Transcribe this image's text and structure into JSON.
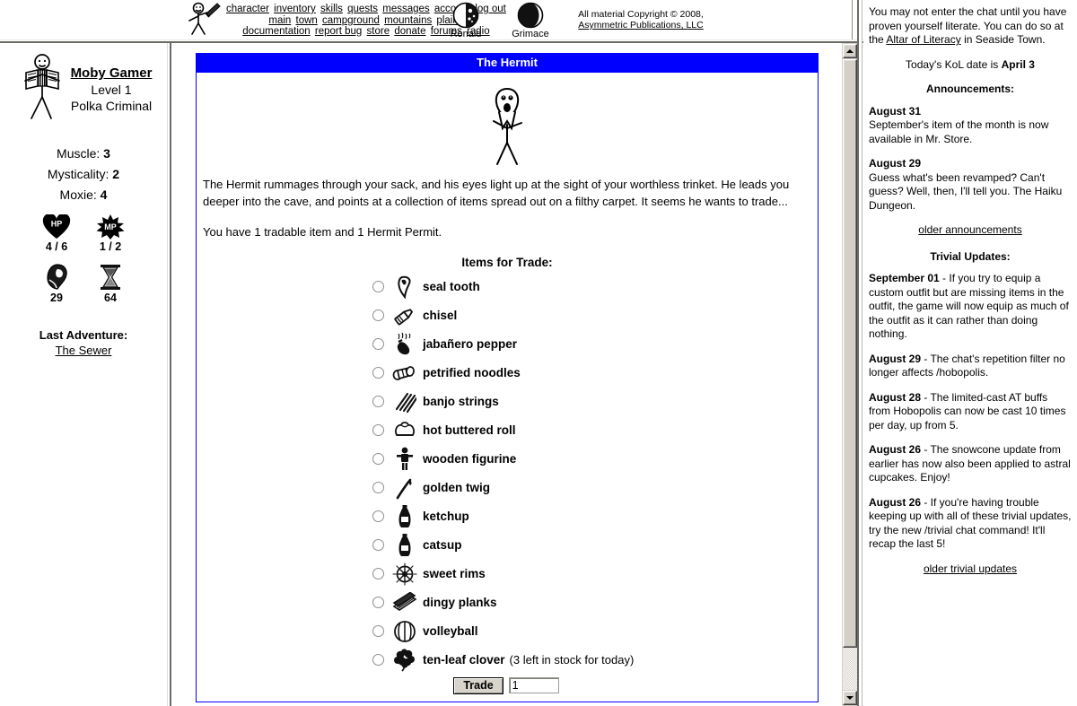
{
  "topnav": {
    "figure_icon": "stick-figure-with-sword-icon",
    "rows": [
      [
        "character",
        "inventory",
        "skills",
        "quests",
        "messages",
        "account",
        "log out"
      ],
      [
        "main",
        "town",
        "campground",
        "mountains",
        "plains"
      ],
      [
        "documentation",
        "report bug",
        "store",
        "donate",
        "forums",
        "radio"
      ]
    ],
    "moons": [
      {
        "name": "Ronald",
        "icon": "moon-phase-icon"
      },
      {
        "name": "Grimace",
        "icon": "moon-phase-icon"
      }
    ],
    "copyright_line1": "All material Copyright © 2008,",
    "copyright_line2": "Asymmetric Publications, LLC"
  },
  "charpane": {
    "avatar_icon": "accordion-player-avatar-icon",
    "name": "Moby Gamer",
    "level": "Level 1",
    "class": "Polka Criminal",
    "stats": [
      {
        "label": "Muscle:",
        "value": "3"
      },
      {
        "label": "Mysticality:",
        "value": "2"
      },
      {
        "label": "Moxie:",
        "value": "4"
      }
    ],
    "hp": {
      "icon": "hp-heart-icon",
      "value": "4 / 6"
    },
    "mp": {
      "icon": "mp-starburst-icon",
      "value": "1 / 2"
    },
    "meat": {
      "icon": "meat-icon",
      "value": "29"
    },
    "adventures": {
      "icon": "hourglass-icon",
      "value": "64"
    },
    "last_adventure_label": "Last Adventure:",
    "last_adventure_link": "The Sewer"
  },
  "main": {
    "title": "The Hermit",
    "hermit_icon": "hermit-stick-figure-icon",
    "paragraphs": [
      "The Hermit rummages through your sack, and his eyes light up at the sight of your worthless trinket. He leads you deeper into the cave, and points at a collection of items spread out on a filthy carpet. It seems he wants to trade...",
      "You have 1 tradable item and 1 Hermit Permit."
    ],
    "items_header": "Items for Trade:",
    "items": [
      {
        "name": "seal tooth",
        "icon": "seal-tooth-icon",
        "stock": ""
      },
      {
        "name": "chisel",
        "icon": "chisel-icon",
        "stock": ""
      },
      {
        "name": "jabañero pepper",
        "icon": "pepper-icon",
        "stock": ""
      },
      {
        "name": "petrified noodles",
        "icon": "noodles-icon",
        "stock": ""
      },
      {
        "name": "banjo strings",
        "icon": "banjo-strings-icon",
        "stock": ""
      },
      {
        "name": "hot buttered roll",
        "icon": "buttered-roll-icon",
        "stock": ""
      },
      {
        "name": "wooden figurine",
        "icon": "wooden-figurine-icon",
        "stock": ""
      },
      {
        "name": "golden twig",
        "icon": "golden-twig-icon",
        "stock": ""
      },
      {
        "name": "ketchup",
        "icon": "ketchup-bottle-icon",
        "stock": ""
      },
      {
        "name": "catsup",
        "icon": "catsup-bottle-icon",
        "stock": ""
      },
      {
        "name": "sweet rims",
        "icon": "sweet-rims-icon",
        "stock": ""
      },
      {
        "name": "dingy planks",
        "icon": "dingy-planks-icon",
        "stock": ""
      },
      {
        "name": "volleyball",
        "icon": "volleyball-icon",
        "stock": ""
      },
      {
        "name": "ten-leaf clover",
        "icon": "clover-icon",
        "stock": "(3 left in stock for today)"
      }
    ],
    "trade_button": "Trade",
    "trade_quantity": "1"
  },
  "chatpane": {
    "literacy_notice_pre": "You may not enter the chat until you have proven yourself literate. You can do so at the ",
    "literacy_link": "Altar of Literacy",
    "literacy_notice_post": " in Seaside Town.",
    "kol_date_prefix": "Today's KoL date is ",
    "kol_date": "April 3",
    "announcements_header": "Announcements:",
    "announcements": [
      {
        "date": "August 31",
        "body": "September's item of the month is now available in Mr. Store."
      },
      {
        "date": "August 29",
        "body": "Guess what's been revamped? Can't guess? Well, then, I'll tell you. The Haiku Dungeon."
      }
    ],
    "older_announcements_link": "older announcements",
    "trivial_header": "Trivial Updates:",
    "trivial_updates": [
      {
        "date": "September 01",
        "body": " - If you try to equip a custom outfit but are missing items in the outfit, the game will now equip as much of the outfit as it can rather than doing nothing."
      },
      {
        "date": "August 29",
        "body": " - The chat's repetition filter no longer affects /hobopolis."
      },
      {
        "date": "August 28",
        "body": " - The limited-cast AT buffs from Hobopolis can now be cast 10 times per day, up from 5."
      },
      {
        "date": "August 26",
        "body": " - The snowcone update from earlier has now also been applied to astral cupcakes. Enjoy!"
      },
      {
        "date": "August 26",
        "body": " - If you're having trouble keeping up with all of these trivial updates, try the new /trivial chat command! It'll recap the last 5!"
      }
    ],
    "older_trivial_link": "older trivial updates"
  },
  "scrollbar": {
    "up_icon": "scroll-up-arrow-icon",
    "down_icon": "scroll-down-arrow-icon"
  },
  "colors": {
    "accent_blue": "#0000FF",
    "chrome_gray": "#D4D0C8"
  }
}
